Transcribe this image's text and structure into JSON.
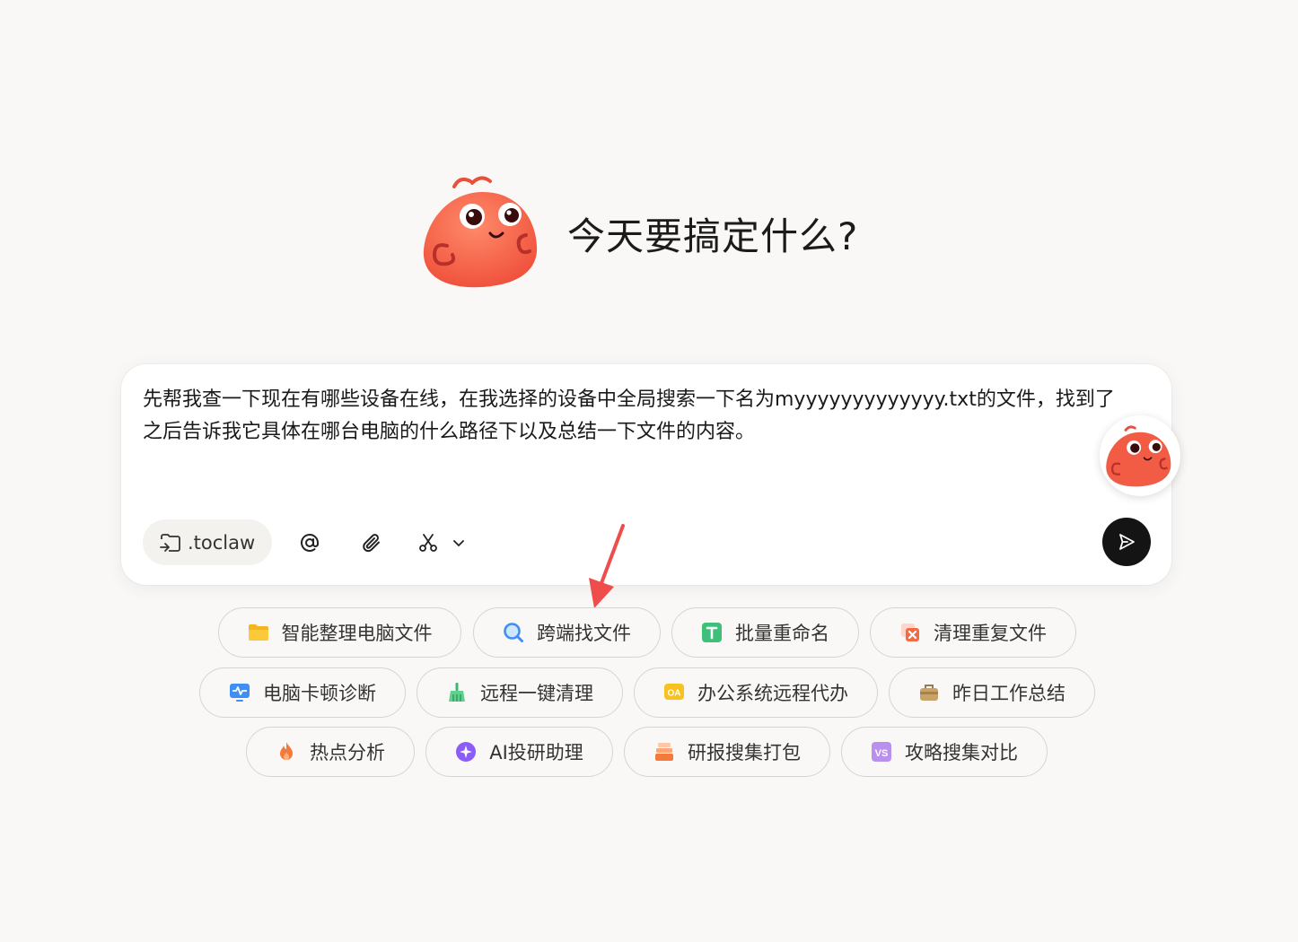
{
  "header": {
    "title": "今天要搞定什么?"
  },
  "composer": {
    "prompt": "先帮我查一下现在有哪些设备在线，在我选择的设备中全局搜索一下名为myyyyyyyyyyyyy.txt的文件，找到了之后告诉我它具体在哪台电脑的什么路径下以及总结一下文件的内容。",
    "directory_label": ".toclaw",
    "tools": [
      "at-icon",
      "paperclip-icon",
      "scissors-icon",
      "chevron-down-icon"
    ],
    "send_icon": "send-icon"
  },
  "suggestions": {
    "row1": [
      {
        "label": "智能整理电脑文件",
        "icon": "folder-icon"
      },
      {
        "label": "跨端找文件",
        "icon": "search-icon"
      },
      {
        "label": "批量重命名",
        "icon": "text-t-icon"
      },
      {
        "label": "清理重复文件",
        "icon": "duplicate-delete-icon"
      }
    ],
    "row2": [
      {
        "label": "电脑卡顿诊断",
        "icon": "monitor-pulse-icon"
      },
      {
        "label": "远程一键清理",
        "icon": "broom-icon"
      },
      {
        "label": "办公系统远程代办",
        "icon": "oa-icon"
      },
      {
        "label": "昨日工作总结",
        "icon": "briefcase-icon"
      }
    ],
    "row3": [
      {
        "label": "热点分析",
        "icon": "flame-icon"
      },
      {
        "label": "AI投研助理",
        "icon": "ai-sparkle-icon"
      },
      {
        "label": "研报搜集打包",
        "icon": "stack-icon"
      },
      {
        "label": "攻略搜集对比",
        "icon": "vs-icon"
      }
    ]
  },
  "colors": {
    "accent": "#f25c45",
    "send": "#141414",
    "arrow": "#ef4c4c"
  }
}
